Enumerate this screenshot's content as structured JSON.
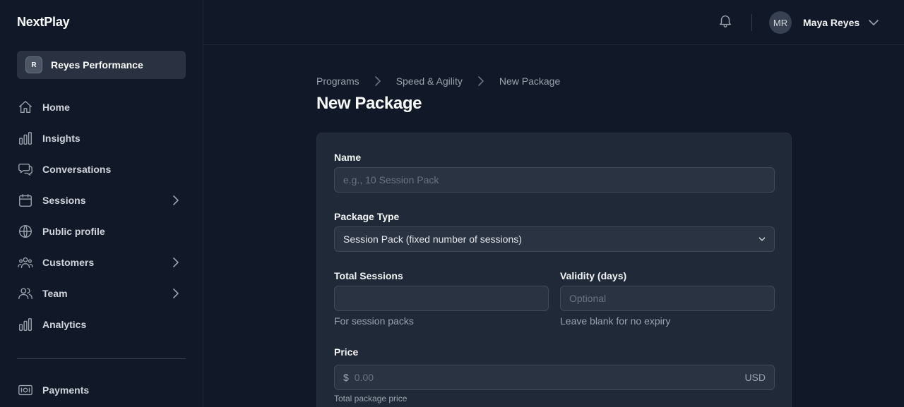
{
  "app": {
    "name": "NextPlay"
  },
  "org": {
    "badge": "R",
    "name": "Reyes Performance"
  },
  "sidebar": {
    "items": [
      {
        "label": "Home",
        "icon": "home-icon"
      },
      {
        "label": "Insights",
        "icon": "bar-chart-icon"
      },
      {
        "label": "Conversations",
        "icon": "chat-bubbles-icon"
      },
      {
        "label": "Sessions",
        "icon": "calendar-icon",
        "expandable": true
      },
      {
        "label": "Public profile",
        "icon": "globe-icon"
      },
      {
        "label": "Customers",
        "icon": "users-group-icon",
        "expandable": true
      },
      {
        "label": "Team",
        "icon": "users-icon",
        "expandable": true
      },
      {
        "label": "Analytics",
        "icon": "bar-chart-icon"
      }
    ],
    "bottom": [
      {
        "label": "Payments",
        "icon": "banknote-icon"
      }
    ]
  },
  "header": {
    "user": {
      "initials": "MR",
      "name": "Maya Reyes"
    }
  },
  "breadcrumb": [
    "Programs",
    "Speed & Agility",
    "New Package"
  ],
  "page": {
    "title": "New Package"
  },
  "form": {
    "name": {
      "label": "Name",
      "placeholder": "e.g., 10 Session Pack",
      "value": ""
    },
    "package_type": {
      "label": "Package Type",
      "value": "Session Pack (fixed number of sessions)"
    },
    "total_sessions": {
      "label": "Total Sessions",
      "value": "",
      "help": "For session packs"
    },
    "validity": {
      "label": "Validity (days)",
      "placeholder": "Optional",
      "help": "Leave blank for no expiry"
    },
    "price": {
      "label": "Price",
      "prefix": "$",
      "placeholder": "0.00",
      "currency": "USD",
      "help": "Total package price"
    }
  }
}
